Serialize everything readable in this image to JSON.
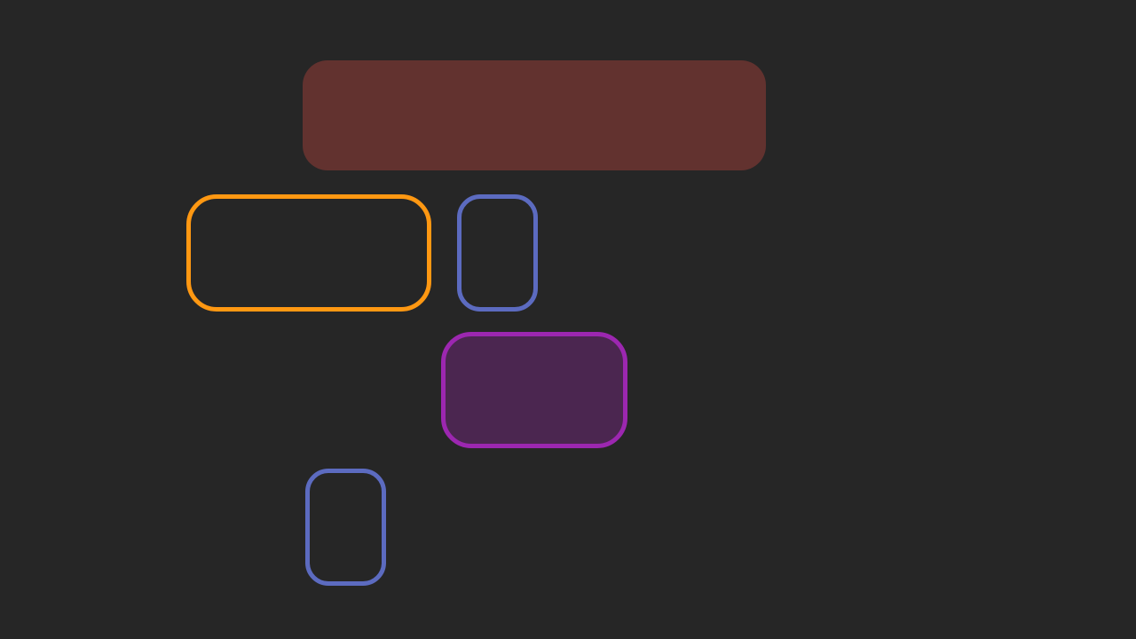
{
  "colors": {
    "background": "#262626",
    "banner_fill": "#62322f",
    "orange_stroke": "#ff9812",
    "blue_stroke": "#5c6bc0",
    "purple_stroke": "#9c27b0",
    "purple_fill": "#4b2650"
  },
  "shapes": [
    {
      "id": "banner",
      "kind": "filled-rounded-rect",
      "fill": "#62322f"
    },
    {
      "id": "orange-box",
      "kind": "outlined-rounded-rect",
      "stroke": "#ff9812"
    },
    {
      "id": "blue-box-upper",
      "kind": "outlined-rounded-rect",
      "stroke": "#5c6bc0"
    },
    {
      "id": "purple-box",
      "kind": "filled-outlined-rounded-rect",
      "stroke": "#9c27b0",
      "fill": "#4b2650"
    },
    {
      "id": "blue-box-lower",
      "kind": "outlined-rounded-rect",
      "stroke": "#5c6bc0"
    }
  ]
}
